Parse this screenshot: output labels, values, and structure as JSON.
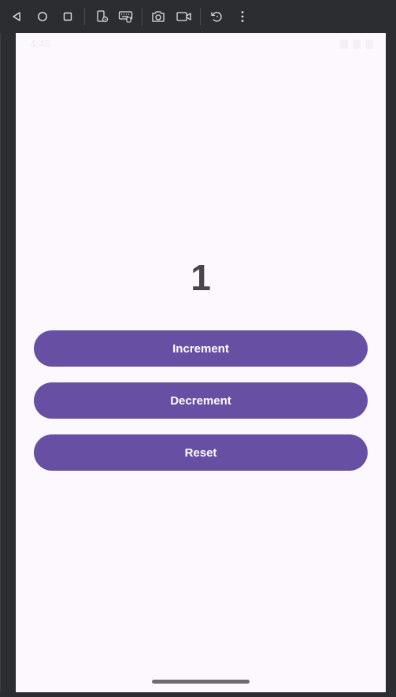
{
  "status_bar": {
    "time": "4:45"
  },
  "counter": {
    "value": "1"
  },
  "buttons": {
    "increment_label": "Increment",
    "decrement_label": "Decrement",
    "reset_label": "Reset"
  },
  "toolbar": {
    "icons": [
      "back-icon",
      "home-icon",
      "overview-icon",
      "device-settings-icon",
      "keyboard-icon",
      "camera-icon",
      "video-record-icon",
      "rotate-icon",
      "more-options-icon"
    ]
  },
  "colors": {
    "primary": "#6750a4",
    "screen_background": "#fdf7fe",
    "counter_text": "#49454f",
    "emulator_chrome": "#2b2d30"
  }
}
